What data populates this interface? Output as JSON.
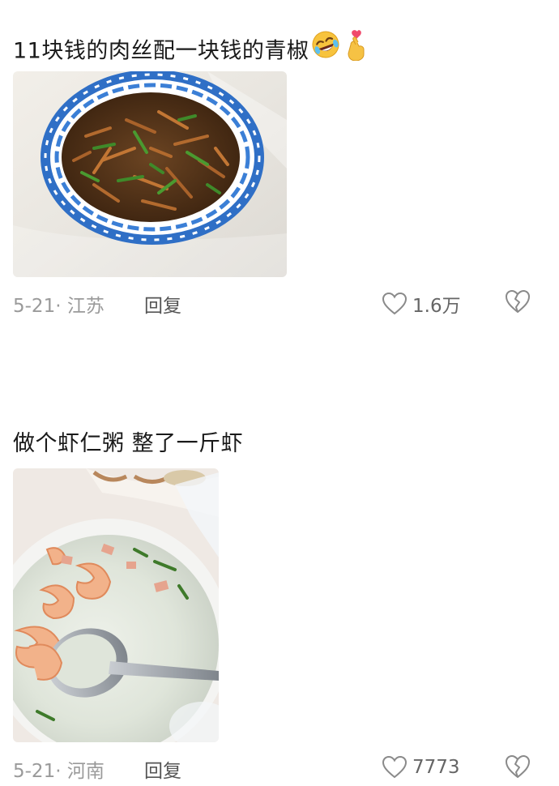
{
  "comments": [
    {
      "text": "11块钱的肉丝配一块钱的青椒",
      "emojis": [
        "rolling-on-floor-laughing",
        "finger-heart"
      ],
      "image": "shredded-pork-with-green-peppers-in-blue-plate",
      "date_location": "5-21· 江苏",
      "reply_label": "回复",
      "likes": "1.6万"
    },
    {
      "text": "做个虾仁粥 整了一斤虾",
      "image": "shrimp-congee-in-white-bowl",
      "date_location": "5-21· 河南",
      "reply_label": "回复",
      "likes": "7773"
    }
  ],
  "colors": {
    "meta_text": "#9a9a9a",
    "comment_text": "#1a1a1a",
    "icon_stroke": "#8a8a8a",
    "plate_blue": "#2f6fc6"
  }
}
